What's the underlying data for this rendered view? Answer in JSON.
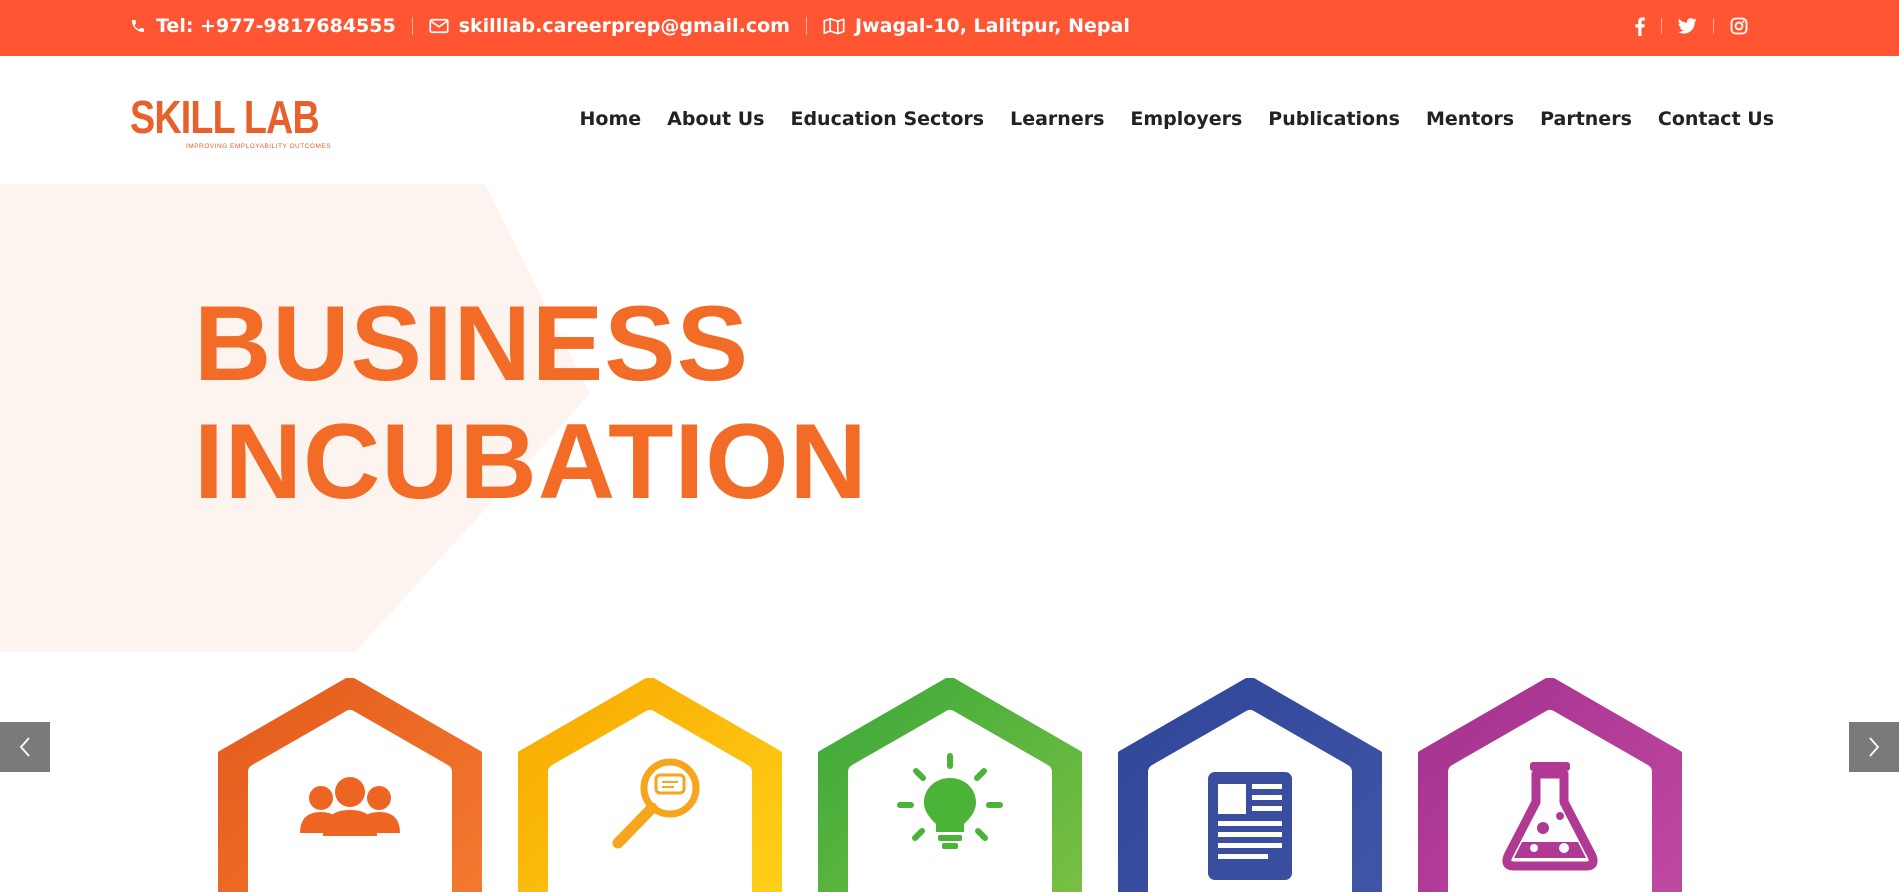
{
  "topbar": {
    "phone": "Tel: +977-9817684555",
    "email": "skilllab.careerprep@gmail.com",
    "address": "Jwagal-10, Lalitpur, Nepal",
    "social": [
      "facebook-icon",
      "twitter-icon",
      "instagram-icon"
    ]
  },
  "logo": {
    "name": "SKILL LAB",
    "tagline": "IMPROVING EMPLOYABILITY OUTCOMES"
  },
  "nav": {
    "items": [
      "Home",
      "About Us",
      "Education Sectors",
      "Learners",
      "Employers",
      "Publications",
      "Mentors",
      "Partners",
      "Contact Us"
    ]
  },
  "hero": {
    "title_line1": "BUSINESS",
    "title_line2": "INCUBATION",
    "icons": [
      {
        "name": "people-icon",
        "color": "#ee6422"
      },
      {
        "name": "magnifier-chat-icon",
        "color": "#f7b500"
      },
      {
        "name": "lightbulb-icon",
        "color": "#4cb339"
      },
      {
        "name": "document-icon",
        "color": "#3a4ea0"
      },
      {
        "name": "flask-icon",
        "color": "#b03a93"
      }
    ]
  },
  "colors": {
    "brand": "#ff5533",
    "accent": "#f26b27"
  }
}
